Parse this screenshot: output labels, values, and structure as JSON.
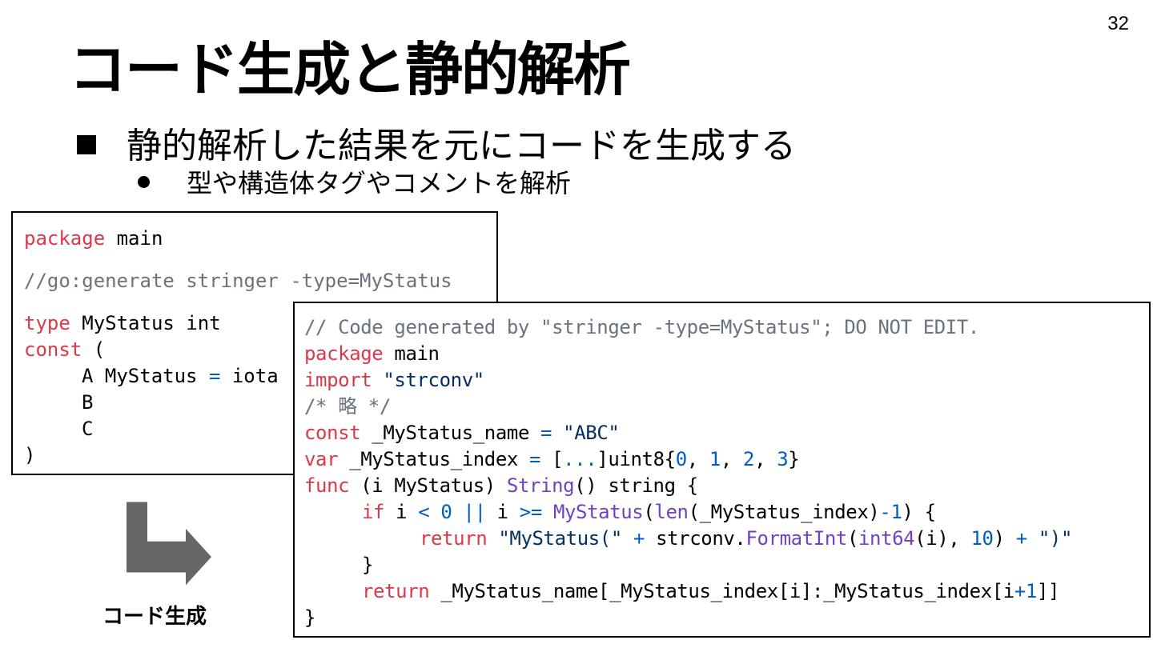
{
  "slide": {
    "page_number": "32",
    "title": "コード生成と静的解析",
    "bullet_level1": "静的解析した結果を元にコードを生成する",
    "bullet_level2": "型や構造体タグやコメントを解析",
    "arrow_label": "コード生成"
  },
  "source_code": {
    "line1": {
      "kw": "package",
      "rest": " main"
    },
    "line2": {
      "comment": "//go:generate stringer -type=MyStatus"
    },
    "line3": {
      "kw": "type",
      "rest": " MyStatus int"
    },
    "line4": {
      "kw": "const",
      "rest": " ("
    },
    "line5": {
      "a": "A MyStatus ",
      "op": "=",
      "b": " iota"
    },
    "line6": "B",
    "line7": "C",
    "line8": ")"
  },
  "generated_code": {
    "line1": "// Code generated by \"stringer -type=MyStatus\"; DO NOT EDIT.",
    "line2": {
      "kw": "package",
      "rest": " main"
    },
    "line3": {
      "kw": "import",
      "str": "\"strconv\""
    },
    "line4": "/* 略 */",
    "line5": {
      "kw": "const",
      "name": " _MyStatus_name ",
      "op": "=",
      "str": "\"ABC\""
    },
    "line6": {
      "kw": "var",
      "name": " _MyStatus_index ",
      "op": "=",
      "dots": "...",
      "type": "uint8{",
      "n0": "0",
      "n1": "1",
      "n2": "2",
      "n3": "3"
    },
    "line7": {
      "kw": "func",
      "recv": " (i MyStatus) ",
      "fn": "String",
      "rest": "() string {"
    },
    "line8": {
      "kw": "if",
      "i": " i ",
      "lt": "<",
      "zero": "0",
      "or": "||",
      "i2": " i ",
      "ge": ">=",
      "fn1": "MyStatus",
      "fn2": "len",
      "arg": "(_MyStatus_index)",
      "minus": "-1",
      "end": ") {"
    },
    "line9": {
      "kw": "return",
      "s1": "\"MyStatus(\"",
      "plus": "+",
      "pkg": " strconv.",
      "fn": "FormatInt",
      "fn2": "int64",
      "arg": "(i), ",
      "ten": "10",
      "s2": "\")\""
    },
    "line10": "}",
    "line11": {
      "kw": "return",
      "a": " _MyStatus_name[_MyStatus_index[i]:_MyStatus_index[i",
      "plus": "+",
      "one": "1",
      "b": "]]"
    },
    "line12": "}"
  }
}
